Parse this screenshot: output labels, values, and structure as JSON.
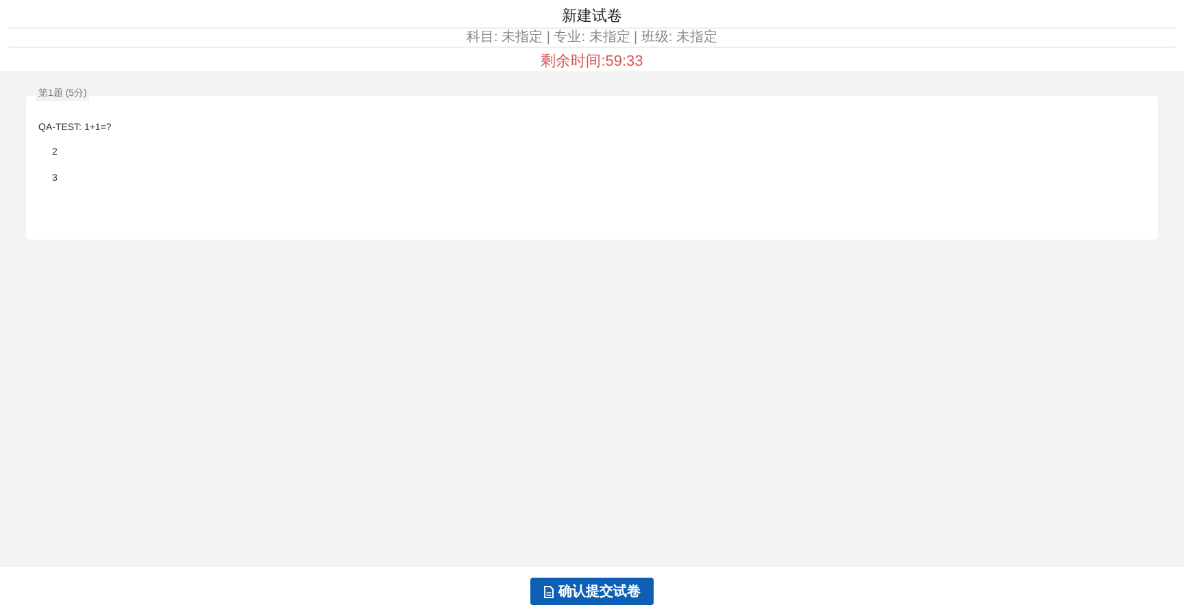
{
  "header": {
    "title": "新建试卷",
    "subtitle": "科目: 未指定 | 专业: 未指定 | 班级: 未指定",
    "timer": "剩余时间:59:33"
  },
  "questions": [
    {
      "legend": "第1题 (5分)",
      "text": "QA-TEST: 1+1=?",
      "options": [
        "2",
        "3"
      ]
    }
  ],
  "submit_button": {
    "label": "确认提交试卷"
  }
}
